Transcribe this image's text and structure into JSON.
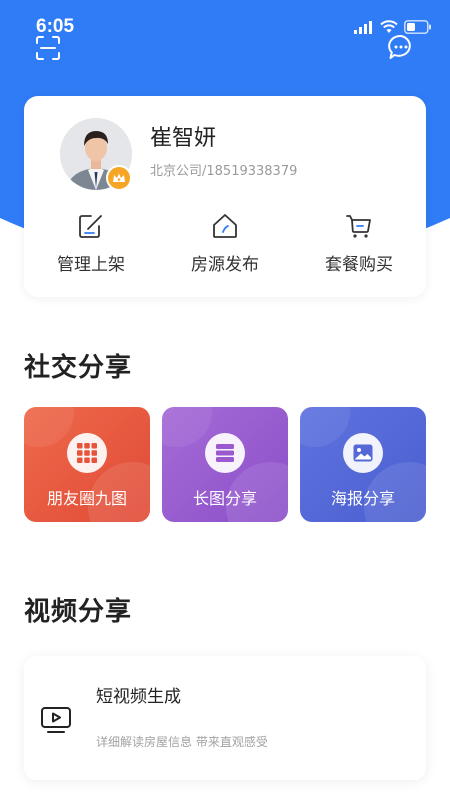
{
  "status_bar": {
    "time": "6:05"
  },
  "header": {
    "scan_icon": "scan-icon",
    "message_icon": "chat-bubble-icon",
    "hero_color": "#2f7cf6"
  },
  "profile": {
    "name": "崔智妍",
    "subtitle": "北京公司/18519338379",
    "badge_icon": "crown-icon",
    "badge_color": "#f6a524"
  },
  "quick_actions": [
    {
      "label": "管理上架",
      "icon": "edit-icon"
    },
    {
      "label": "房源发布",
      "icon": "house-icon"
    },
    {
      "label": "套餐购买",
      "icon": "cart-icon"
    }
  ],
  "social_share": {
    "title": "社交分享",
    "cards": [
      {
        "label": "朋友圈九图",
        "icon": "grid-icon",
        "color": "#e8533c"
      },
      {
        "label": "长图分享",
        "icon": "long-image-icon",
        "color": "#9b59cf"
      },
      {
        "label": "海报分享",
        "icon": "poster-image-icon",
        "color": "#5569d6"
      }
    ]
  },
  "video_share": {
    "title": "视频分享",
    "item": {
      "title": "短视频生成",
      "description": "详细解读房屋信息 带来直观感受",
      "icon": "video-play-icon"
    }
  }
}
